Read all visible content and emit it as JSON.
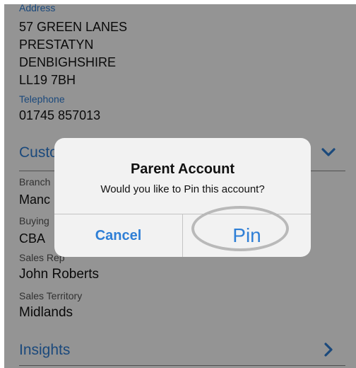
{
  "address": {
    "label": "Address",
    "line1": "57 GREEN LANES",
    "line2": "PRESTATYN",
    "line3": "DENBIGHSHIRE",
    "line4": "LL19 7BH"
  },
  "telephone": {
    "label": "Telephone",
    "value": "01745 857013"
  },
  "customer_section": {
    "title": "Custo",
    "fields": [
      {
        "label": "Branch",
        "value": "Manc"
      },
      {
        "label": "Buying",
        "value": "CBA"
      },
      {
        "label": "Sales Rep",
        "value": "John Roberts"
      },
      {
        "label": "Sales Territory",
        "value": "Midlands"
      }
    ]
  },
  "insights": {
    "title": "Insights"
  },
  "dialog": {
    "title": "Parent Account",
    "message": "Would you like to Pin this account?",
    "cancel_label": "Cancel",
    "pin_label": "Pin"
  },
  "colors": {
    "accent": "#2f7fd6",
    "overlay": "rgba(0,0,0,0.42)",
    "dialog_bg": "#f2f2f2"
  },
  "icons": {
    "customer_section_toggle": "chevron-down-icon",
    "insights_disclosure": "chevron-right-icon"
  }
}
